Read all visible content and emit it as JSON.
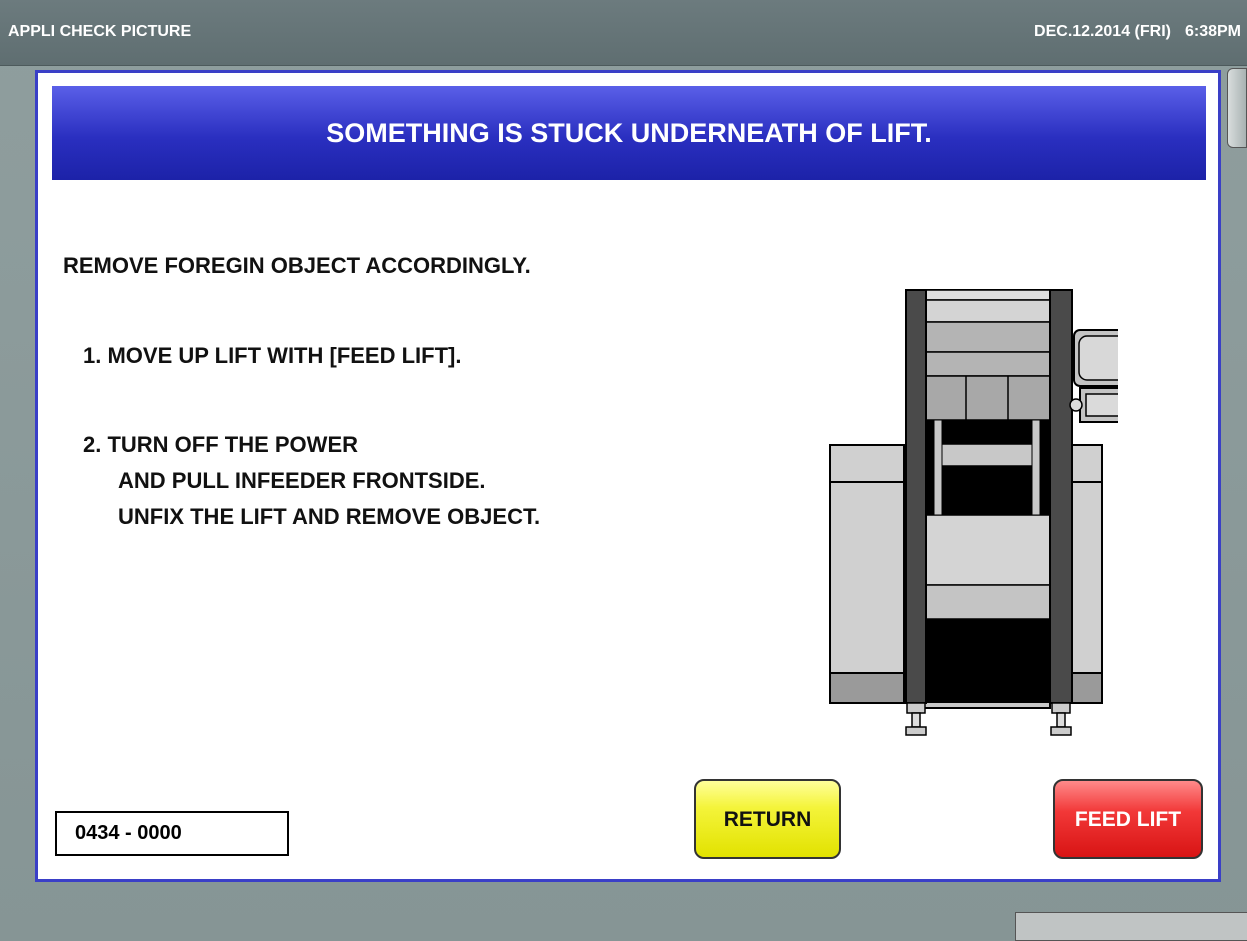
{
  "titlebar": {
    "title": "APPLI CHECK PICTURE",
    "date": "DEC.12.2014 (FRI)",
    "time": "6:38PM"
  },
  "dialog": {
    "header": "SOMETHING IS STUCK UNDERNEATH OF LIFT.",
    "instruction": "REMOVE FOREGIN OBJECT ACCORDINGLY.",
    "step1": "1. MOVE UP LIFT WITH [FEED LIFT].",
    "step2_line1": "2. TURN OFF THE POWER",
    "step2_line2": "AND PULL INFEEDER FRONTSIDE.",
    "step2_line3": "UNFIX THE LIFT AND REMOVE OBJECT.",
    "error_code": "0434 - 0000",
    "return_label": "RETURN",
    "feed_lift_label": "FEED LIFT"
  },
  "colors": {
    "header_blue": "#2a2fc0",
    "dialog_border": "#3a3fc7",
    "return_yellow": "#f4f43a",
    "feed_red": "#f23838",
    "background": "#8a9a9a"
  },
  "icons": {
    "machine": "machine-lift-illustration"
  }
}
